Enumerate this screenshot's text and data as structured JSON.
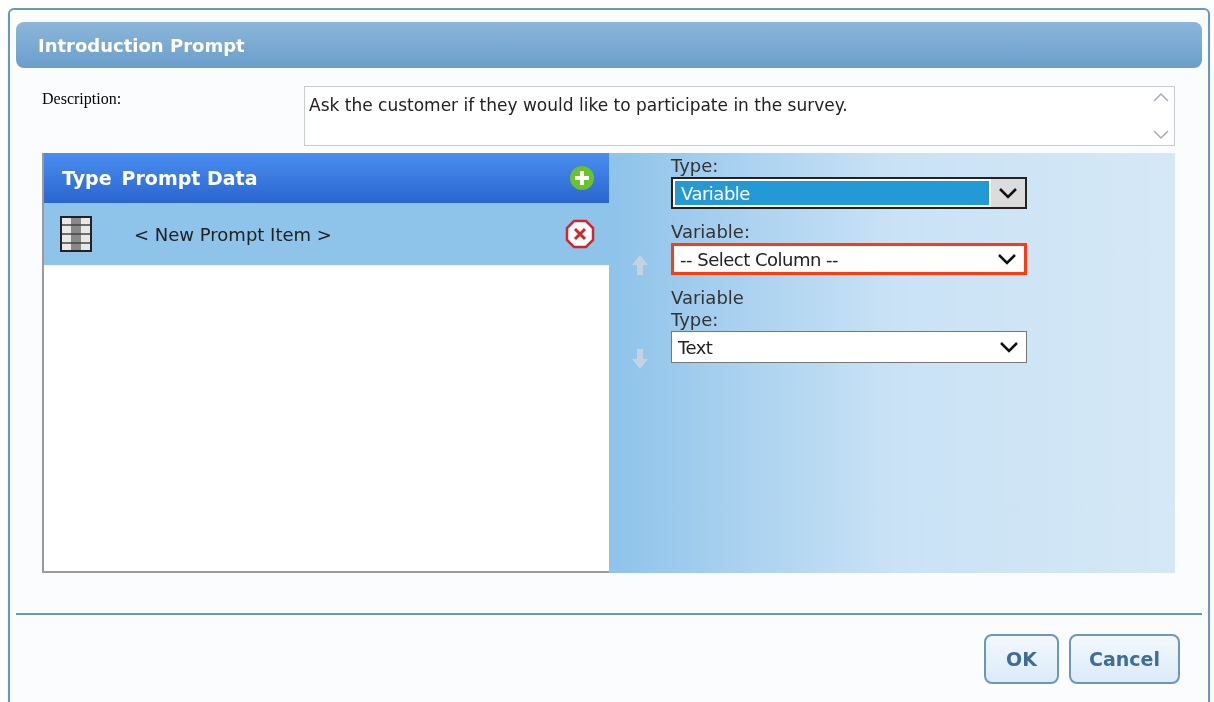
{
  "dialog": {
    "title": "Introduction Prompt"
  },
  "description": {
    "label": "Description:",
    "value": "Ask the customer if they would like to participate in the survey."
  },
  "prompt_list": {
    "columns": [
      "Type",
      "Prompt Data"
    ],
    "items": [
      {
        "label": "< New Prompt Item >",
        "selected": true
      }
    ]
  },
  "fields": [
    {
      "label": "Type:",
      "value": "Variable",
      "highlighted": true,
      "invalid": false
    },
    {
      "label": "Variable:",
      "value": "-- Select Column --",
      "highlighted": false,
      "invalid": true
    },
    {
      "label": "Variable Type:",
      "value": "Text",
      "highlighted": false,
      "invalid": false
    }
  ],
  "buttons": [
    "OK",
    "Cancel"
  ]
}
